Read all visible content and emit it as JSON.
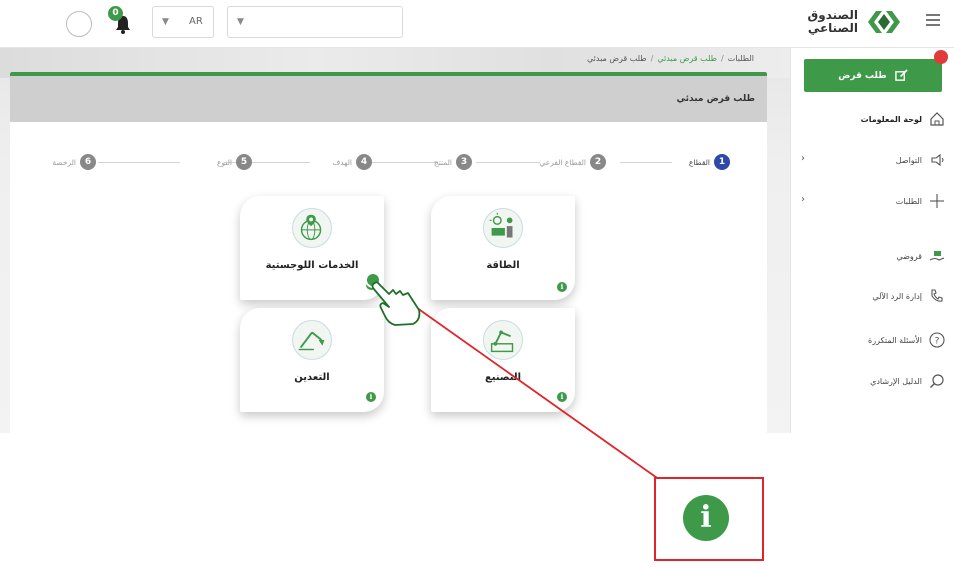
{
  "header": {
    "logo_text_line1": "الصندوق",
    "logo_text_line2": "الصناعي",
    "language": "AR",
    "notification_count": "0"
  },
  "breadcrumb": {
    "items": [
      "الطلبات",
      "طلب قرض مبدئي",
      "طلب قرض مبدئي"
    ],
    "separator": "/"
  },
  "card": {
    "title": "طلب قرض مبدئي"
  },
  "stepper": {
    "steps": [
      {
        "num": "1",
        "label": "القطاع",
        "active": true
      },
      {
        "num": "2",
        "label": "القطاع الفرعي",
        "active": false
      },
      {
        "num": "3",
        "label": "المنتج",
        "active": false
      },
      {
        "num": "4",
        "label": "الهدف",
        "active": false
      },
      {
        "num": "5",
        "label": "النوع",
        "active": false
      },
      {
        "num": "6",
        "label": "الرخصة",
        "active": false
      }
    ]
  },
  "sectors": [
    {
      "label": "الطاقة",
      "icon": "energy-icon"
    },
    {
      "label": "الخدمات اللوجستية",
      "icon": "logistics-globe-icon"
    },
    {
      "label": "التصنيع",
      "icon": "manufacturing-robot-arm-icon"
    },
    {
      "label": "التعدين",
      "icon": "mining-excavator-icon"
    }
  ],
  "sidebar": {
    "new_loan_label": "طلب قرض",
    "new_loan_badge": "",
    "items": [
      {
        "label": "لوحة المعلومات",
        "icon": "home-icon"
      },
      {
        "label": "التواصل",
        "icon": "megaphone-icon"
      },
      {
        "label": "الطلبات",
        "icon": "plus-icon"
      },
      {
        "label": "قروضي",
        "icon": "hand-money-icon"
      },
      {
        "label": "إدارة الرد الآلي",
        "icon": "phone-icon"
      },
      {
        "label": "الأسئلة المتكررة",
        "icon": "question-icon"
      },
      {
        "label": "الدليل الإرشادي",
        "icon": "search-icon"
      }
    ]
  },
  "callout": {
    "info_glyph": "i"
  },
  "colors": {
    "brand_green": "#3e9a49",
    "active_step": "#2d4aa8",
    "callout_red": "#e0242b"
  }
}
